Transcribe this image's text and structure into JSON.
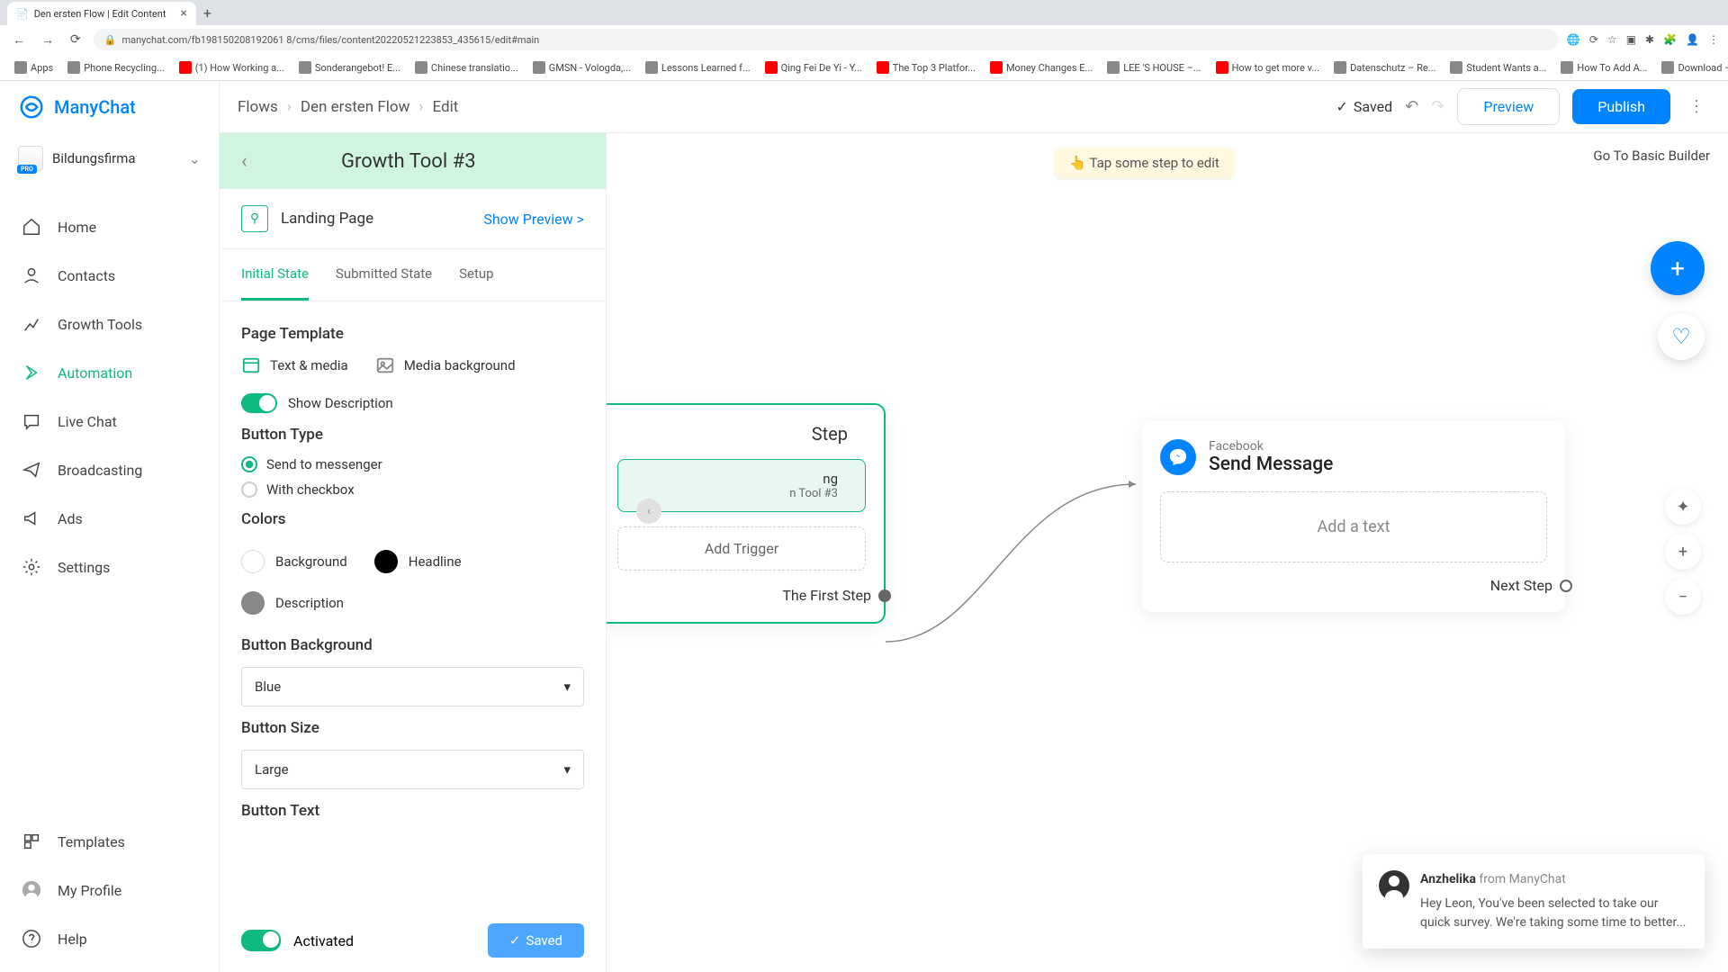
{
  "browser": {
    "tab_title": "Den ersten Flow | Edit Content",
    "url": "manychat.com/fb198150208192061 8/cms/files/content20220521223853_435615/edit#main",
    "bookmarks": [
      "Apps",
      "Phone Recycling...",
      "(1) How Working a...",
      "Sonderangebot! E...",
      "Chinese translatio...",
      "GMSN - Vologda,...",
      "Lessons Learned f...",
      "Qing Fei De Yi - Y...",
      "The Top 3 Platfor...",
      "Money Changes E...",
      "LEE 'S HOUSE –...",
      "How to get more v...",
      "Datenschutz – Re...",
      "Student Wants a...",
      "How To Add A...",
      "Download – Cooki..."
    ]
  },
  "brand": "ManyChat",
  "account": {
    "name": "Bildungsfirma",
    "badge": "PRO"
  },
  "nav": {
    "items": [
      "Home",
      "Contacts",
      "Growth Tools",
      "Automation",
      "Live Chat",
      "Broadcasting",
      "Ads",
      "Settings"
    ],
    "bottom": [
      "Templates",
      "My Profile",
      "Help"
    ]
  },
  "topbar": {
    "crumbs": [
      "Flows",
      "Den ersten Flow",
      "Edit"
    ],
    "saved": "Saved",
    "preview": "Preview",
    "publish": "Publish"
  },
  "panel": {
    "title": "Growth Tool #3",
    "landing": "Landing Page",
    "show_preview": "Show Preview >",
    "tabs": [
      "Initial State",
      "Submitted State",
      "Setup"
    ],
    "page_template": "Page Template",
    "text_media": "Text & media",
    "media_bg": "Media background",
    "show_desc": "Show Description",
    "button_type": "Button Type",
    "send_messenger": "Send to messenger",
    "with_checkbox": "With checkbox",
    "colors": "Colors",
    "bg": "Background",
    "headline": "Headline",
    "description": "Description",
    "button_bg": "Button Background",
    "blue": "Blue",
    "button_size": "Button Size",
    "large": "Large",
    "button_text": "Button Text",
    "activated": "Activated",
    "saved_btn": "Saved"
  },
  "canvas": {
    "hint": "👆 Tap some step to edit",
    "go_basic": "Go To Basic Builder",
    "start_title": "Step",
    "start_label": "ng",
    "start_sub": "n Tool #3",
    "add_trigger": "Add Trigger",
    "first_step": "The First Step",
    "fb": "Facebook",
    "send_msg": "Send Message",
    "add_text": "Add a text",
    "next_step": "Next Step"
  },
  "chat": {
    "name": "Anzhelika",
    "from": "from ManyChat",
    "body": "Hey Leon,  You've been selected to take our quick survey. We're taking some time to better..."
  }
}
